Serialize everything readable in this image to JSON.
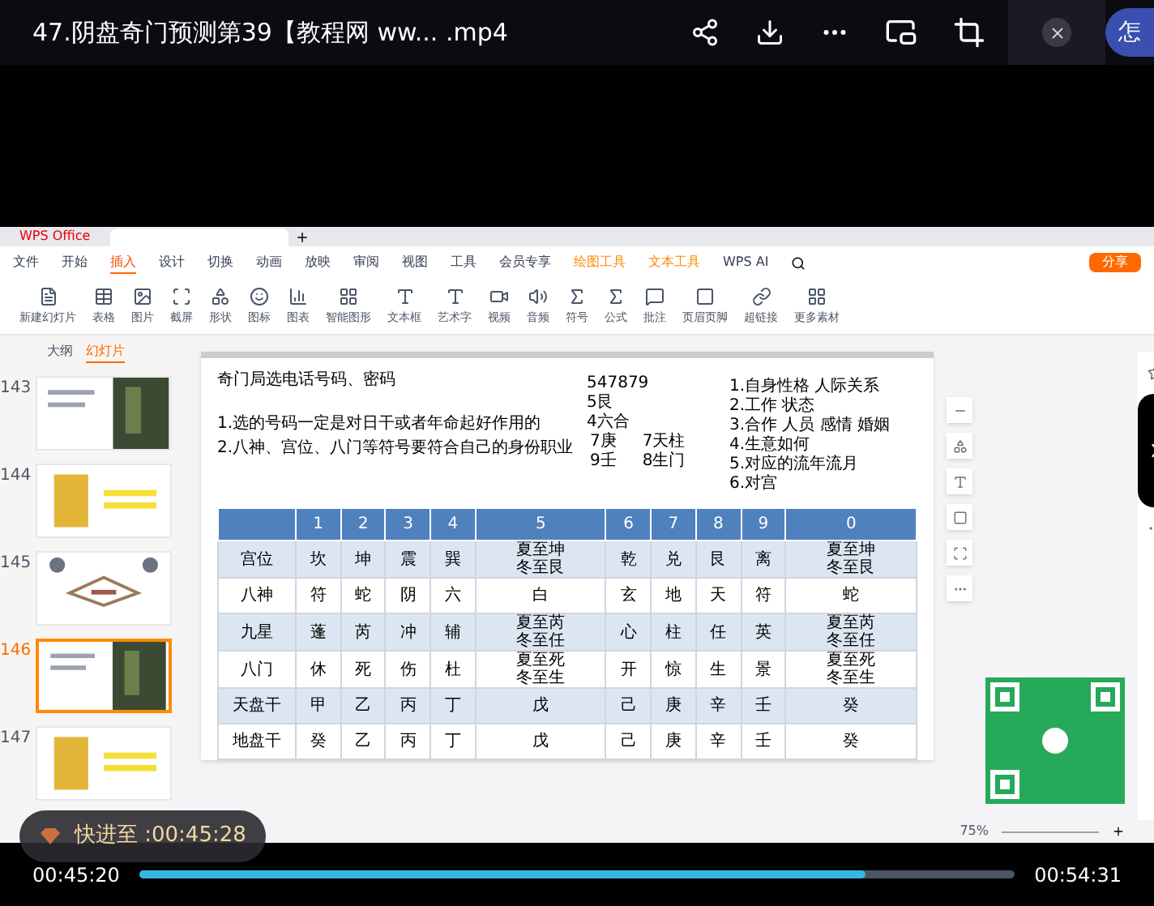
{
  "player": {
    "title": "47.阴盘奇门预测第39【教程网 ww...  .mp4",
    "edge_button": "怎"
  },
  "wps": {
    "app_tab": "WPS Office",
    "menu": [
      {
        "label": "文件",
        "selected": false,
        "kind": "plain"
      },
      {
        "label": "开始",
        "selected": false,
        "kind": "plain"
      },
      {
        "label": "插入",
        "selected": true,
        "kind": "plain"
      },
      {
        "label": "设计",
        "selected": false,
        "kind": "plain"
      },
      {
        "label": "切换",
        "selected": false,
        "kind": "plain"
      },
      {
        "label": "动画",
        "selected": false,
        "kind": "plain"
      },
      {
        "label": "放映",
        "selected": false,
        "kind": "plain"
      },
      {
        "label": "审阅",
        "selected": false,
        "kind": "plain"
      },
      {
        "label": "视图",
        "selected": false,
        "kind": "plain"
      },
      {
        "label": "工具",
        "selected": false,
        "kind": "plain"
      },
      {
        "label": "会员专享",
        "selected": false,
        "kind": "plain"
      },
      {
        "label": "绘图工具",
        "selected": false,
        "kind": "context"
      },
      {
        "label": "文本工具",
        "selected": false,
        "kind": "context"
      },
      {
        "label": "WPS AI",
        "selected": false,
        "kind": "plain"
      }
    ],
    "share_button": "分享",
    "ribbon": [
      {
        "label": "新建幻灯片"
      },
      {
        "label": "表格"
      },
      {
        "label": "图片"
      },
      {
        "label": "截屏"
      },
      {
        "label": "形状"
      },
      {
        "label": "图标"
      },
      {
        "label": "图表"
      },
      {
        "label": "智能图形"
      },
      {
        "label": "文本框"
      },
      {
        "label": "艺术字"
      },
      {
        "label": "视频"
      },
      {
        "label": "音频"
      },
      {
        "label": "符号"
      },
      {
        "label": "公式"
      },
      {
        "label": "批注"
      },
      {
        "label": "页眉页脚"
      },
      {
        "label": "超链接"
      },
      {
        "label": "更多素材"
      }
    ],
    "panel_tabs": [
      {
        "label": "大纲",
        "selected": false
      },
      {
        "label": "幻灯片",
        "selected": true
      }
    ],
    "thumbnails": [
      {
        "number": "143",
        "selected": false
      },
      {
        "number": "144",
        "selected": false
      },
      {
        "number": "145",
        "selected": false
      },
      {
        "number": "146",
        "selected": true
      },
      {
        "number": "147",
        "selected": false
      }
    ],
    "slide": {
      "title": "奇门局选电话号码、密码",
      "rules": [
        "1.选的号码一定是对日干或者年命起好作用的",
        "2.八神、宫位、八门等符号要符合自己的身份职业"
      ],
      "number": "547879",
      "notes": [
        "5艮",
        "4六合"
      ],
      "pairs": [
        [
          "7庚",
          "7天柱"
        ],
        [
          "9壬",
          "8生门"
        ]
      ],
      "aspects": [
        "1.自身性格 人际关系",
        "2.工作 状态",
        "3.合作 人员 感情 婚姻",
        "4.生意如何",
        "5.对应的流年流月",
        "6.对宫"
      ],
      "table": {
        "columns": [
          "1",
          "2",
          "3",
          "4",
          "5",
          "6",
          "7",
          "8",
          "9",
          "0"
        ],
        "rows": [
          {
            "label": "宫位",
            "cells": [
              "坎",
              "坤",
              "震",
              "巽",
              "夏至坤冬至艮",
              "乾",
              "兑",
              "艮",
              "离",
              "夏至坤冬至艮"
            ]
          },
          {
            "label": "八神",
            "cells": [
              "符",
              "蛇",
              "阴",
              "六",
              "白",
              "玄",
              "地",
              "天",
              "符",
              "蛇"
            ]
          },
          {
            "label": "九星",
            "cells": [
              "蓬",
              "芮",
              "冲",
              "辅",
              "夏至芮冬至任",
              "心",
              "柱",
              "任",
              "英",
              "夏至芮冬至任"
            ]
          },
          {
            "label": "八门",
            "cells": [
              "休",
              "死",
              "伤",
              "杜",
              "夏至死冬至生",
              "开",
              "惊",
              "生",
              "景",
              "夏至死冬至生"
            ]
          },
          {
            "label": "天盘干",
            "cells": [
              "甲",
              "乙",
              "丙",
              "丁",
              "戊",
              "己",
              "庚",
              "辛",
              "壬",
              "癸"
            ]
          },
          {
            "label": "地盘干",
            "cells": [
              "癸",
              "乙",
              "丙",
              "丁",
              "戊",
              "己",
              "庚",
              "辛",
              "壬",
              "癸"
            ]
          }
        ]
      }
    },
    "zoom": "75%"
  },
  "toast": "快进至 :00:45:28",
  "controls": {
    "elapsed": "00:45:20",
    "total": "00:54:31",
    "level": 0.83
  }
}
